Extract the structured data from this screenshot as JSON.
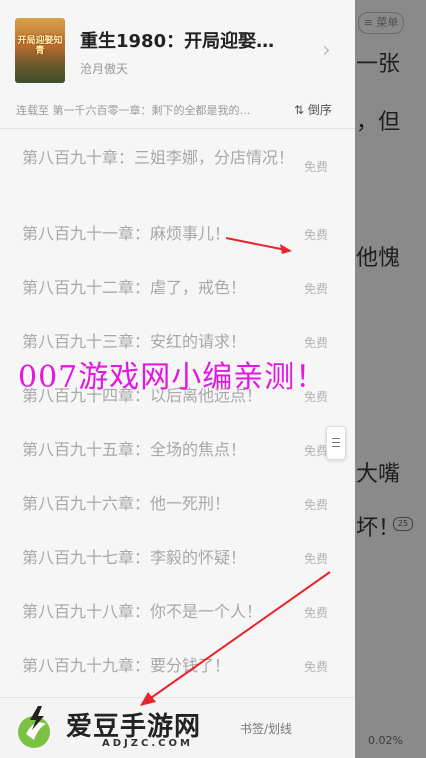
{
  "reader": {
    "menu_label": "≡ 菜单",
    "lines": [
      "一张",
      "，但",
      "他愧",
      "大嘴",
      "坏！"
    ],
    "comment_count": "25",
    "progress": "0.02%"
  },
  "book": {
    "title": "重生1980：开局迎娶…",
    "author": "沧月傲天",
    "cover_text": "开局迎娶知青"
  },
  "status": {
    "text": "连载至 第一千六百零一章：剩下的全都是我的…",
    "sort_label": "⇅ 倒序"
  },
  "chapters": [
    {
      "title": "第八百九十章：三姐李娜，分店情况！",
      "badge": "免费"
    },
    {
      "title": "第八百九十一章：麻烦事儿！",
      "badge": "免费"
    },
    {
      "title": "第八百九十二章：虐了，戒色！",
      "badge": "免费"
    },
    {
      "title": "第八百九十三章：安红的请求！",
      "badge": "免费"
    },
    {
      "title": "第八百九十四章：以后离他远点！",
      "badge": "免费"
    },
    {
      "title": "第八百九十五章：全场的焦点！",
      "badge": "免费"
    },
    {
      "title": "第八百九十六章：他一死刑！",
      "badge": "免费"
    },
    {
      "title": "第八百九十七章：李毅的怀疑！",
      "badge": "免费"
    },
    {
      "title": "第八百九十八章：你不是一个人！",
      "badge": "免费"
    },
    {
      "title": "第八百九十九章：要分钱了！",
      "badge": "免费"
    }
  ],
  "bottom": {
    "label": "书签/划线"
  },
  "watermark": {
    "text": "007游戏网小编亲测！",
    "logo_text": "爱豆手游网",
    "logo_sub": "ADJZC.COM"
  },
  "colors": {
    "watermark": "#e218e2",
    "arrow": "#e8242c",
    "logo_green": "#7cc242"
  },
  "icons": [
    "chevron-right-icon",
    "sort-icon",
    "menu-icon",
    "comment-icon",
    "scroll-handle-icon",
    "logo-icon"
  ]
}
